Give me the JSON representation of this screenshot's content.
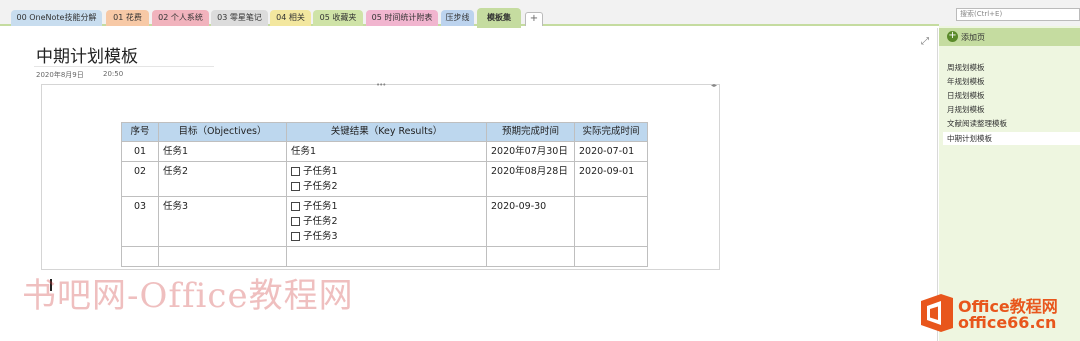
{
  "sections": [
    {
      "label": "00 OneNote技能分解",
      "color": "#c8ddef"
    },
    {
      "label": "01 花费",
      "color": "#f7c9a6"
    },
    {
      "label": "02 个人系统",
      "color": "#f1b3bd"
    },
    {
      "label": "03 零星笔记",
      "color": "#dcdcdc"
    },
    {
      "label": "04 相关",
      "color": "#f3e79f"
    },
    {
      "label": "05 收藏夹",
      "color": "#cfe3a7"
    },
    {
      "label": "05 时间统计附表",
      "color": "#f1b5cf"
    },
    {
      "label": "压步线",
      "color": "#bcd3ee"
    },
    {
      "label": "模板集",
      "color": "#c5dca0",
      "active": true
    }
  ],
  "add_section_label": "+",
  "page": {
    "title": "中期计划模板",
    "date": "2020年8月9日",
    "time": "20:50"
  },
  "table": {
    "headers": [
      "序号",
      "目标（Objectives）",
      "关键结果（Key Results）",
      "预期完成时间",
      "实际完成时间"
    ],
    "rows": [
      {
        "no": "01",
        "goal": "任务1",
        "key_results": [
          "任务1"
        ],
        "checkbox": false,
        "planned": "2020年07月30日",
        "actual": "2020-07-01"
      },
      {
        "no": "02",
        "goal": "任务2",
        "key_results": [
          "子任务1",
          "子任务2"
        ],
        "checkbox": true,
        "planned": "2020年08月28日",
        "actual": "2020-09-01"
      },
      {
        "no": "03",
        "goal": "任务3",
        "key_results": [
          "子任务1",
          "子任务2",
          "子任务3"
        ],
        "checkbox": true,
        "planned": "2020-09-30",
        "actual": ""
      },
      {
        "no": "",
        "goal": "",
        "key_results": [
          ""
        ],
        "checkbox": false,
        "planned": "",
        "actual": ""
      }
    ]
  },
  "watermark": "书吧网-Office教程网",
  "sidebar": {
    "search_placeholder": "搜索(Ctrl+E)",
    "add_page_label": "添加页",
    "pages": [
      "周规划模板",
      "年规划模板",
      "日规划模板",
      "月规划模板",
      "文献阅读整理模板",
      "中期计划模板"
    ],
    "active_page": "中期计划模板"
  },
  "logo": {
    "line1": "Office教程网",
    "line2": "office66.cn",
    "brand_color": "#e8561c"
  }
}
